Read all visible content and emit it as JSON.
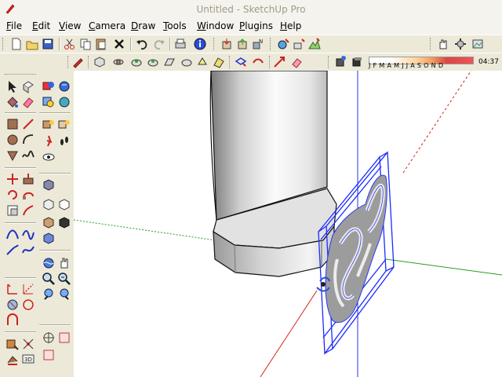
{
  "window": {
    "title": "Untitled - SketchUp Pro"
  },
  "menu": [
    "File",
    "Edit",
    "View",
    "Camera",
    "Draw",
    "Tools",
    "Window",
    "Plugins",
    "Help"
  ],
  "shadow": {
    "months": "JFMAMJJASOND",
    "time": "04:37"
  },
  "colors": {
    "x_axis": "#d42020",
    "y_axis": "#20a020",
    "z_axis": "#2030e0",
    "selection": "#1a2bff"
  }
}
